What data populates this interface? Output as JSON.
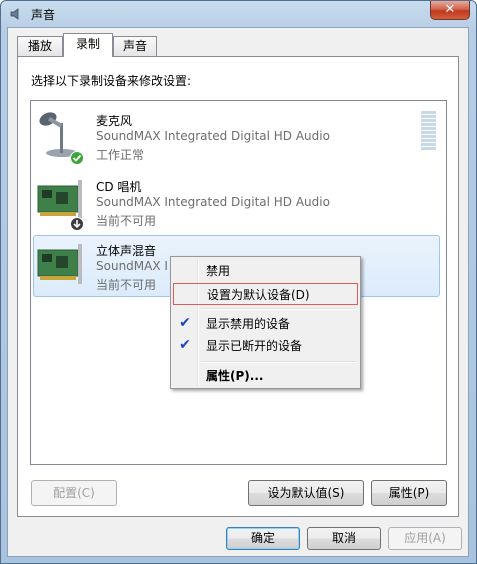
{
  "window": {
    "title": "声音",
    "close_label": "✕"
  },
  "tabs": [
    {
      "label": "播放"
    },
    {
      "label": "录制"
    },
    {
      "label": "声音"
    }
  ],
  "instruction": "选择以下录制设备来修改设置:",
  "devices": [
    {
      "name": "麦克风",
      "driver": "SoundMAX Integrated Digital HD Audio",
      "status": "工作正常"
    },
    {
      "name": "CD 唱机",
      "driver": "SoundMAX Integrated Digital HD Audio",
      "status": "当前不可用"
    },
    {
      "name": "立体声混音",
      "driver": "SoundMAX I",
      "status": "当前不可用"
    }
  ],
  "context_menu": {
    "disable": "禁用",
    "set_default": "设置为默认设备(D)",
    "show_disabled": "显示禁用的设备",
    "show_disconnected": "显示已断开的设备",
    "properties": "属性(P)..."
  },
  "buttons": {
    "configure": "配置(C)",
    "set_default": "设为默认值(S)",
    "properties": "属性(P)",
    "ok": "确定",
    "cancel": "取消",
    "apply": "应用(A)"
  },
  "colors": {
    "accent_check": "#1a46c3",
    "status_ok": "#3aa63a",
    "selection": "#dcebfc",
    "close": "#c0381d"
  },
  "icons": {
    "mic": "microphone-icon",
    "card": "sound-card-icon",
    "ok_badge": "check-badge-icon",
    "down_badge": "arrow-down-badge-icon"
  }
}
